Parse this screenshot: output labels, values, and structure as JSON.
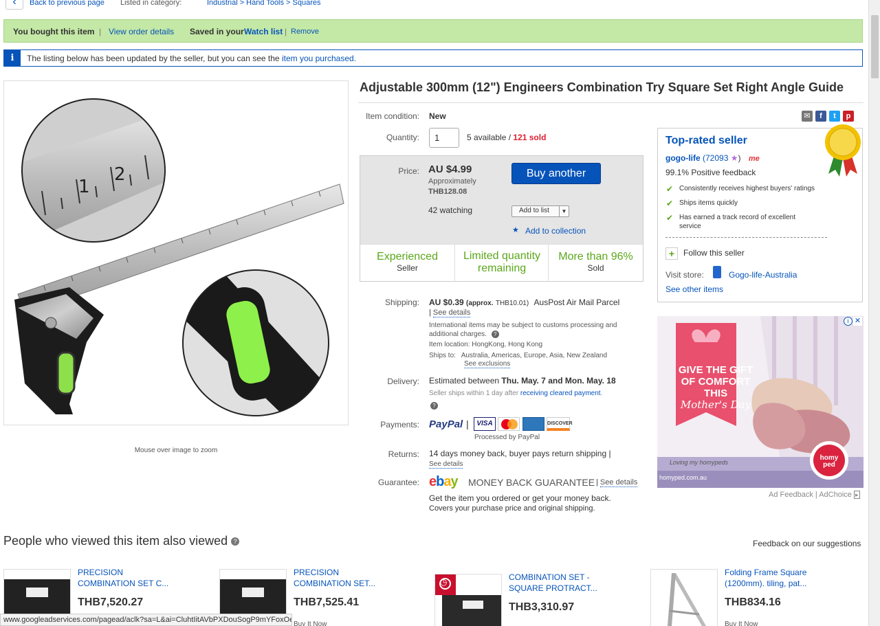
{
  "nav": {
    "back_label": "Back to previous page",
    "listed_label": "Listed in category:",
    "categories": "Industrial  >  Hand Tools  >  Squares"
  },
  "banner": {
    "bought": "You bought this item",
    "sep1": "|",
    "view_order": "View order details",
    "saved_prefix": "Saved in your",
    "watch_list": "Watch list",
    "sep2": "|",
    "remove": "Remove"
  },
  "notice": {
    "text": "The listing below has been updated by the seller, but you can see the",
    "link": "item you purchased."
  },
  "image": {
    "zoom_hint": "Mouse over image to zoom"
  },
  "item": {
    "title": "Adjustable 300mm (12\") Engineers Combination Try Square Set Right Angle Guide",
    "condition_label": "Item condition:",
    "condition": "New",
    "quantity_label": "Quantity:",
    "quantity_value": "1",
    "available": "5 available /",
    "sold": "121 sold",
    "price_label": "Price:",
    "price": "AU $4.99",
    "approx_label": "Approximately",
    "approx_price": "THB128.08",
    "watching": "42 watching",
    "buy_button": "Buy another",
    "add_to_list": "Add to list",
    "add_collection": "Add to collection"
  },
  "signals": [
    {
      "big": "Experienced",
      "small": "Seller"
    },
    {
      "big": "Limited quantity remaining",
      "small": ""
    },
    {
      "big": "More than 96%",
      "small": "Sold"
    }
  ],
  "shipping": {
    "label": "Shipping:",
    "price": "AU $0.39",
    "approx": "(approx.",
    "approx_val": "THB10.01)",
    "service": "AusPost Air Mail Parcel",
    "see_details": "See details",
    "note1": "International items may be subject to customs processing and",
    "note2": "additional charges.",
    "location_label": "Item location:",
    "location": "HongKong, Hong Kong",
    "ships_label": "Ships to:",
    "ships_to": "Australia, Americas, Europe, Asia, New Zealand",
    "exclusions": "See exclusions"
  },
  "delivery": {
    "label": "Delivery:",
    "text": "Estimated between",
    "dates": "Thu. May. 7 and Mon. May. 18",
    "note": "Seller ships within 1 day after",
    "note_link": "receiving cleared payment"
  },
  "payments": {
    "label": "Payments:",
    "paypal": "PayPal",
    "processed": "Processed by PayPal"
  },
  "returns": {
    "label": "Returns:",
    "text": "14 days money back, buyer pays return shipping |",
    "see_details": "See details"
  },
  "guarantee": {
    "label": "Guarantee:",
    "mbg": "MONEY BACK GUARANTEE",
    "see_details": "See details",
    "line1": "Get the item you ordered or get your money back.",
    "line2": "Covers your purchase price and original shipping."
  },
  "seller": {
    "heading": "Top-rated seller",
    "name": "gogo-life",
    "score": "(72093",
    "feedback": "99.1% Positive feedback",
    "points": [
      "Consistently receives highest buyers' ratings",
      "Ships items quickly",
      "Has earned a track record of excellent service"
    ],
    "follow": "Follow this seller",
    "visit_label": "Visit store:",
    "store": "Gogo-life-Australia",
    "other_items": "See other items"
  },
  "ad": {
    "headline1": "GIVE THE GIFT",
    "headline2": "OF COMFORT",
    "headline3": "THIS",
    "headline4": "Mother's Day",
    "tagline": "Loving my homypeds",
    "brand": "homy ped",
    "url": "homyped.com.au",
    "feedback": "Ad Feedback",
    "adchoice": "AdChoice"
  },
  "also_viewed": {
    "title": "People who viewed this item also viewed",
    "feedback": "Feedback on our suggestions",
    "items": [
      {
        "title": "PRECISION COMBINATION SET C...",
        "price": "THB7,520.27",
        "sub": ""
      },
      {
        "title": "PRECISION COMBINATION SET...",
        "price": "THB7,525.41",
        "sub": "Buy It Now"
      },
      {
        "title": "COMBINATION SET - SQUARE PROTRACT...",
        "price": "THB3,310.97",
        "sub": ""
      },
      {
        "title": "Folding Frame Square (1200mm). tiling, pat...",
        "price": "THB834.16",
        "sub": "Buy It Now"
      }
    ]
  },
  "status_url": "www.googleadservices.com/pagead/aclk?sa=L&ai=CluhtIitAVbPXDouSogP9mYFoxOe..."
}
